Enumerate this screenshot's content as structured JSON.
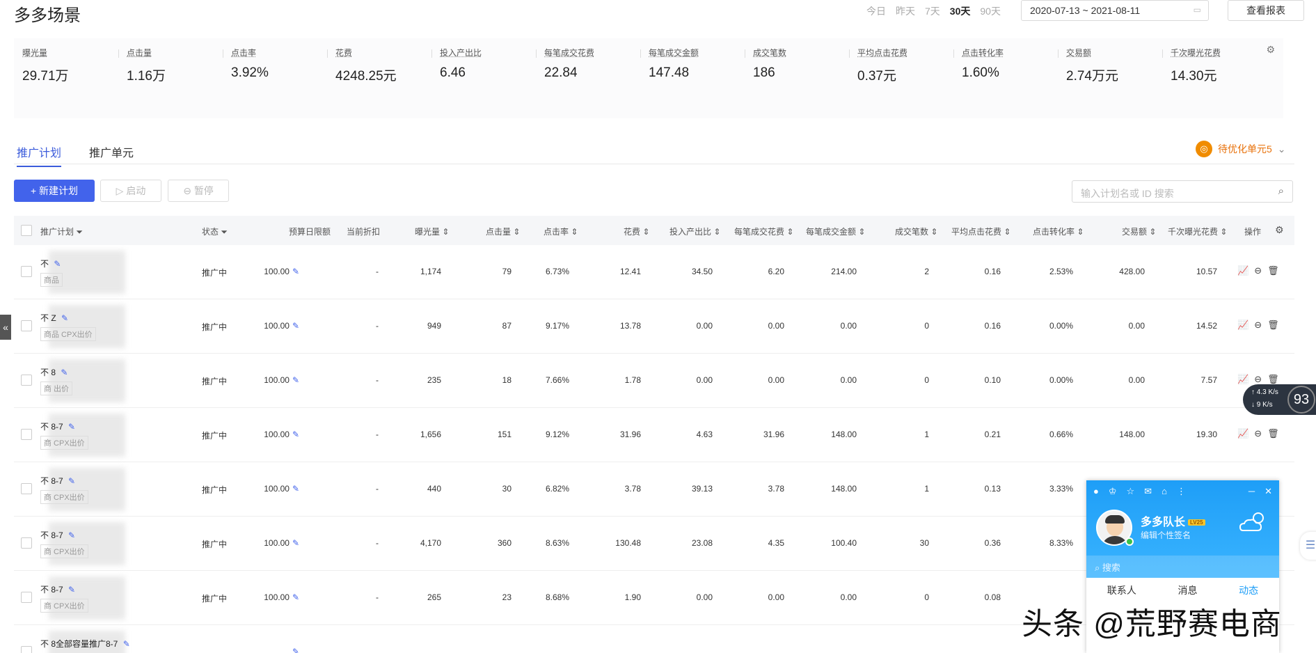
{
  "header": {
    "title": "多多场景",
    "ranges": [
      "今日",
      "昨天",
      "7天",
      "30天",
      "90天"
    ],
    "active_range": "30天",
    "date_range": "2020-07-13 ~ 2021-08-11",
    "report_label": "查看报表"
  },
  "stats": [
    {
      "label": "曝光量",
      "value": "29.71万"
    },
    {
      "label": "点击量",
      "value": "1.16万"
    },
    {
      "label": "点击率",
      "value": "3.92%"
    },
    {
      "label": "花费",
      "value": "4248.25元"
    },
    {
      "label": "投入产出比",
      "value": "6.46"
    },
    {
      "label": "每笔成交花费",
      "value": "22.84"
    },
    {
      "label": "每笔成交金额",
      "value": "147.48"
    },
    {
      "label": "成交笔数",
      "value": "186"
    },
    {
      "label": "平均点击花费",
      "value": "0.37元"
    },
    {
      "label": "点击转化率",
      "value": "1.60%"
    },
    {
      "label": "交易额",
      "value": "2.74万元"
    },
    {
      "label": "千次曝光花费",
      "value": "14.30元"
    }
  ],
  "tabs": [
    {
      "label": "推广计划",
      "active": true
    },
    {
      "label": "推广单元",
      "active": false
    }
  ],
  "pending": {
    "label": "待优化单元5"
  },
  "toolbar": {
    "new_plan": "+ 新建计划",
    "start": "启动",
    "pause": "暂停",
    "search_placeholder": "输入计划名或 ID 搜索"
  },
  "table": {
    "headers": {
      "plan": "推广计划",
      "status": "状态",
      "budget": "预算日限额",
      "discount": "当前折扣",
      "impressions": "曝光量",
      "clicks": "点击量",
      "ctr": "点击率",
      "cost": "花费",
      "roi": "投入产出比",
      "cpo": "每笔成交花费",
      "aov": "每笔成交金额",
      "orders": "成交笔数",
      "cpc": "平均点击花费",
      "cvr": "点击转化率",
      "gmv": "交易额",
      "cpm": "千次曝光花费",
      "ops": "操作"
    },
    "rows": [
      {
        "name": "不",
        "tag": "商品",
        "status": "推广中",
        "budget": "100.00",
        "discount": "-",
        "impressions": "1,174",
        "clicks": "79",
        "ctr": "6.73%",
        "cost": "12.41",
        "roi": "34.50",
        "cpo": "6.20",
        "aov": "214.00",
        "orders": "2",
        "cpc": "0.16",
        "cvr": "2.53%",
        "gmv": "428.00",
        "cpm": "10.57"
      },
      {
        "name": "不 Z",
        "tag": "商品 CPX出价",
        "status": "推广中",
        "budget": "100.00",
        "discount": "-",
        "impressions": "949",
        "clicks": "87",
        "ctr": "9.17%",
        "cost": "13.78",
        "roi": "0.00",
        "cpo": "0.00",
        "aov": "0.00",
        "orders": "0",
        "cpc": "0.16",
        "cvr": "0.00%",
        "gmv": "0.00",
        "cpm": "14.52"
      },
      {
        "name": "不 8",
        "tag": "商 出价",
        "status": "推广中",
        "budget": "100.00",
        "discount": "-",
        "impressions": "235",
        "clicks": "18",
        "ctr": "7.66%",
        "cost": "1.78",
        "roi": "0.00",
        "cpo": "0.00",
        "aov": "0.00",
        "orders": "0",
        "cpc": "0.10",
        "cvr": "0.00%",
        "gmv": "0.00",
        "cpm": "7.57"
      },
      {
        "name": "不 8-7",
        "tag": "商 CPX出价",
        "status": "推广中",
        "budget": "100.00",
        "discount": "-",
        "impressions": "1,656",
        "clicks": "151",
        "ctr": "9.12%",
        "cost": "31.96",
        "roi": "4.63",
        "cpo": "31.96",
        "aov": "148.00",
        "orders": "1",
        "cpc": "0.21",
        "cvr": "0.66%",
        "gmv": "148.00",
        "cpm": "19.30"
      },
      {
        "name": "不 8-7",
        "tag": "商 CPX出价",
        "status": "推广中",
        "budget": "100.00",
        "discount": "-",
        "impressions": "440",
        "clicks": "30",
        "ctr": "6.82%",
        "cost": "3.78",
        "roi": "39.13",
        "cpo": "3.78",
        "aov": "148.00",
        "orders": "1",
        "cpc": "0.13",
        "cvr": "3.33%",
        "gmv": "",
        "cpm": ""
      },
      {
        "name": "不 8-7",
        "tag": "商 CPX出价",
        "status": "推广中",
        "budget": "100.00",
        "discount": "-",
        "impressions": "4,170",
        "clicks": "360",
        "ctr": "8.63%",
        "cost": "130.48",
        "roi": "23.08",
        "cpo": "4.35",
        "aov": "100.40",
        "orders": "30",
        "cpc": "0.36",
        "cvr": "8.33%",
        "gmv": "",
        "cpm": ""
      },
      {
        "name": "不 8-7",
        "tag": "商 CPX出价",
        "status": "推广中",
        "budget": "100.00",
        "discount": "-",
        "impressions": "265",
        "clicks": "23",
        "ctr": "8.68%",
        "cost": "1.90",
        "roi": "0.00",
        "cpo": "0.00",
        "aov": "0.00",
        "orders": "0",
        "cpc": "0.08",
        "cvr": "",
        "gmv": "",
        "cpm": ""
      },
      {
        "name": "不 8全部容量推广8-7",
        "tag": "",
        "status": "",
        "budget": "",
        "discount": "",
        "impressions": "",
        "clicks": "",
        "ctr": "",
        "cost": "",
        "roi": "",
        "cpo": "",
        "aov": "",
        "orders": "",
        "cpc": "",
        "cvr": "",
        "gmv": "",
        "cpm": ""
      }
    ]
  },
  "net_widget": {
    "up": "4.3 K/s",
    "down": "9 K/s",
    "percent": "93"
  },
  "qq": {
    "name": "多多队长",
    "level": "LV25",
    "signature": "编辑个性签名",
    "search_placeholder": "搜索",
    "tabs": [
      "联系人",
      "消息",
      "动态"
    ],
    "active_tab": "动态"
  },
  "watermark": "头条 @荒野赛电商"
}
